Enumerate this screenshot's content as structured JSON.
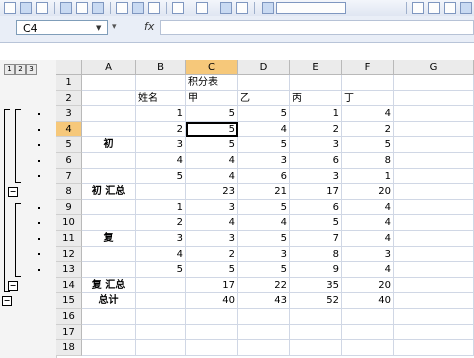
{
  "formula_bar": {
    "name_box": "C4",
    "fx_symbol": "fx",
    "formula": ""
  },
  "outline": {
    "levels": [
      "1",
      "2",
      "3"
    ],
    "collapse_symbol": "−",
    "dot_rows": [
      3,
      4,
      5,
      6,
      7,
      9,
      10,
      11,
      12,
      13
    ],
    "collapse_rows": [
      8,
      14,
      15
    ]
  },
  "sheet": {
    "active_cell": "C4",
    "columns": [
      "A",
      "B",
      "C",
      "D",
      "E",
      "F",
      "G"
    ],
    "rows": [
      {
        "n": "1",
        "cells": [
          "",
          "",
          "积分表",
          "",
          "",
          "",
          ""
        ]
      },
      {
        "n": "2",
        "cells": [
          "",
          "姓名",
          "甲",
          "乙",
          "丙",
          "丁",
          ""
        ]
      },
      {
        "n": "3",
        "cells": [
          "",
          "1",
          "5",
          "5",
          "1",
          "4",
          ""
        ]
      },
      {
        "n": "4",
        "cells": [
          "",
          "2",
          "5",
          "4",
          "2",
          "2",
          ""
        ]
      },
      {
        "n": "5",
        "cells": [
          "初",
          "3",
          "5",
          "5",
          "3",
          "5",
          ""
        ]
      },
      {
        "n": "6",
        "cells": [
          "",
          "4",
          "4",
          "3",
          "6",
          "8",
          ""
        ]
      },
      {
        "n": "7",
        "cells": [
          "",
          "5",
          "4",
          "6",
          "3",
          "1",
          ""
        ]
      },
      {
        "n": "8",
        "cells": [
          "初 汇总",
          "",
          "23",
          "21",
          "17",
          "20",
          ""
        ]
      },
      {
        "n": "9",
        "cells": [
          "",
          "1",
          "3",
          "5",
          "6",
          "4",
          ""
        ]
      },
      {
        "n": "10",
        "cells": [
          "",
          "2",
          "4",
          "4",
          "5",
          "4",
          ""
        ]
      },
      {
        "n": "11",
        "cells": [
          "复",
          "3",
          "3",
          "5",
          "7",
          "4",
          ""
        ]
      },
      {
        "n": "12",
        "cells": [
          "",
          "4",
          "2",
          "3",
          "8",
          "3",
          ""
        ]
      },
      {
        "n": "13",
        "cells": [
          "",
          "5",
          "5",
          "5",
          "9",
          "4",
          ""
        ]
      },
      {
        "n": "14",
        "cells": [
          "复 汇总",
          "",
          "17",
          "22",
          "35",
          "20",
          ""
        ]
      },
      {
        "n": "15",
        "cells": [
          "总计",
          "",
          "40",
          "43",
          "52",
          "40",
          ""
        ]
      },
      {
        "n": "16",
        "cells": [
          "",
          "",
          "",
          "",
          "",
          "",
          ""
        ]
      },
      {
        "n": "17",
        "cells": [
          "",
          "",
          "",
          "",
          "",
          "",
          ""
        ]
      },
      {
        "n": "18",
        "cells": [
          "",
          "",
          "",
          "",
          "",
          "",
          ""
        ]
      }
    ]
  }
}
